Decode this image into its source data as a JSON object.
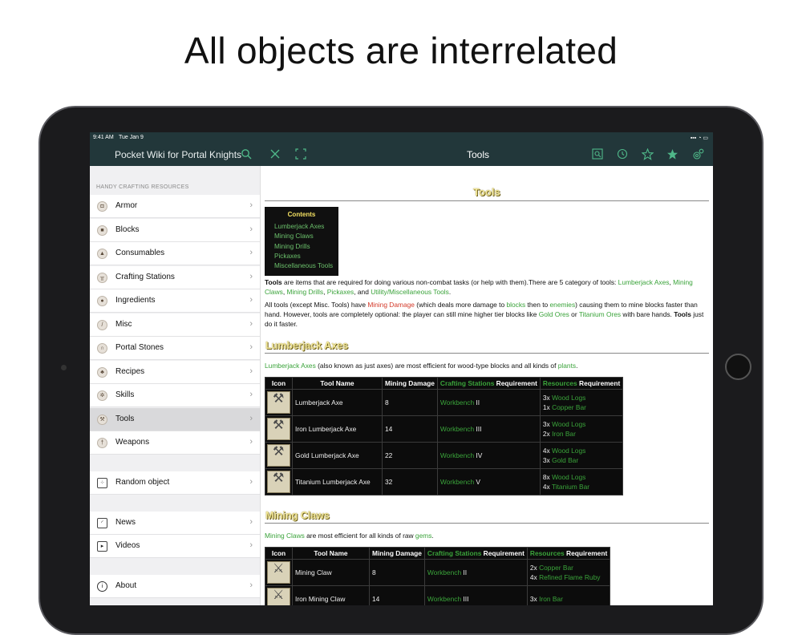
{
  "headline": "All objects are interrelated",
  "status": {
    "time": "9:41 AM",
    "date": "Tue Jan 9",
    "right": "▪▪▪ ◔ ▭"
  },
  "nav": {
    "app_title": "Pocket Wiki for Portal Knights",
    "page_title": "Tools"
  },
  "sidebar": {
    "section": "HANDY CRAFTING RESOURCES",
    "items": [
      {
        "label": "Armor",
        "icon": "armor-icon"
      },
      {
        "label": "Blocks",
        "icon": "blocks-icon"
      },
      {
        "label": "Consumables",
        "icon": "consumables-icon"
      },
      {
        "label": "Crafting Stations",
        "icon": "crafting-station-icon"
      },
      {
        "label": "Ingredients",
        "icon": "ingredients-icon"
      },
      {
        "label": "Misc",
        "icon": "misc-icon"
      },
      {
        "label": "Portal Stones",
        "icon": "portal-stone-icon"
      },
      {
        "label": "Recipes",
        "icon": "recipes-icon"
      },
      {
        "label": "Skills",
        "icon": "skills-icon"
      },
      {
        "label": "Tools",
        "icon": "tools-icon"
      },
      {
        "label": "Weapons",
        "icon": "weapons-icon"
      }
    ],
    "random": "Random object",
    "news": "News",
    "videos": "Videos",
    "about": "About"
  },
  "article": {
    "title": "Tools",
    "toc": {
      "title": "Contents",
      "items": [
        "Lumberjack Axes",
        "Mining Claws",
        "Mining Drills",
        "Pickaxes",
        "Miscellaneous Tools"
      ]
    },
    "intro": {
      "bold": "Tools",
      "t1": " are items that are required for doing various non-combat tasks (or help with them).There are 5 category of tools: ",
      "l1": "Lumberjack Axes",
      "t2": ", ",
      "l2": "Mining Claws",
      "t3": ", ",
      "l3": "Mining Drills",
      "t4": ", ",
      "l4": "Pickaxes",
      "t5": ", and ",
      "l5": "Utility/Miscellaneous Tools",
      "t6": "."
    },
    "intro2": {
      "t1": "All tools (except Misc. Tools) have ",
      "red": "Mining Damage",
      "t2": " (which deals more damage to ",
      "l1": "blocks",
      "t3": " then to ",
      "l2": "enemies",
      "t4": ") causing them to mine blocks faster than hand. However, tools are completely optional: the player can still mine higher tier blocks like ",
      "l3": "Gold Ores",
      "t5": " or ",
      "l4": "Titanium Ores",
      "t6": " with bare hands. ",
      "bold": "Tools",
      "t7": " just do it faster."
    },
    "section1": {
      "title": "Lumberjack Axes",
      "desc_link": "Lumberjack Axes",
      "desc_text": " (also known as just axes) are most efficient for wood-type blocks and all kinds of ",
      "desc_link2": "plants",
      "desc_end": "."
    },
    "section2": {
      "title": "Mining Claws",
      "desc_link": "Mining Claws",
      "desc_text": " are most efficient for all kinds of raw ",
      "desc_link2": "gems",
      "desc_end": "."
    },
    "table_head": {
      "icon": "Icon",
      "name": "Tool Name",
      "damage": "Mining Damage",
      "crafting_link": "Crafting Stations",
      "crafting_text": " Requirement",
      "resources_link": "Resources",
      "resources_text": " Requirement"
    },
    "axes": [
      {
        "name": "Lumberjack Axe",
        "damage": "8",
        "station": "Workbench",
        "tier": " II",
        "r1q": "3x ",
        "r1": "Wood Logs",
        "r2q": "1x ",
        "r2": "Copper Bar"
      },
      {
        "name": "Iron Lumberjack Axe",
        "damage": "14",
        "station": "Workbench",
        "tier": " III",
        "r1q": "3x ",
        "r1": "Wood Logs",
        "r2q": "2x ",
        "r2": "Iron Bar"
      },
      {
        "name": "Gold Lumberjack Axe",
        "damage": "22",
        "station": "Workbench",
        "tier": " IV",
        "r1q": "4x ",
        "r1": "Wood Logs",
        "r2q": "3x ",
        "r2": "Gold Bar"
      },
      {
        "name": "Titanium Lumberjack Axe",
        "damage": "32",
        "station": "Workbench",
        "tier": " V",
        "r1q": "8x ",
        "r1": "Wood Logs",
        "r2q": "4x ",
        "r2": "Titanium Bar"
      }
    ],
    "claws": [
      {
        "name": "Mining Claw",
        "damage": "8",
        "station": "Workbench",
        "tier": " II",
        "r1q": "2x ",
        "r1": "Copper Bar",
        "r2q": "4x ",
        "r2": "Refined Flame Ruby"
      },
      {
        "name": "Iron Mining Claw",
        "damage": "14",
        "station": "Workbench",
        "tier": " III",
        "r1q": "3x ",
        "r1": "Iron Bar",
        "r2q": "",
        "r2": ""
      }
    ]
  }
}
